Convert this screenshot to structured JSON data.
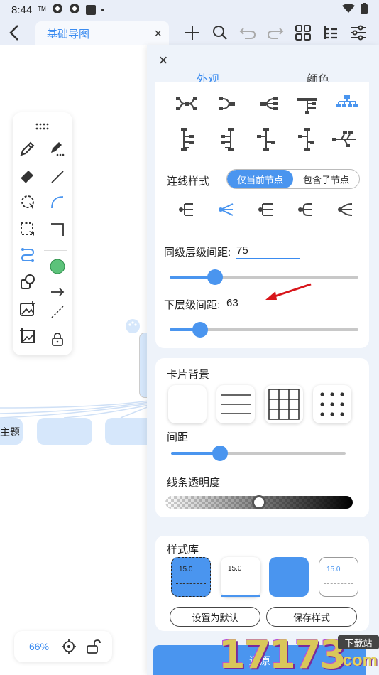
{
  "status_bar": {
    "time": "8:44",
    "network_label": "ᵀᴹ"
  },
  "topbar": {
    "doc_title": "基础导图",
    "close_glyph": "×"
  },
  "canvas": {
    "node_label": "主题"
  },
  "zoom": {
    "value": "66%"
  },
  "panel": {
    "close_glyph": "×",
    "tabs": [
      "外观",
      "颜色"
    ],
    "active_tab": "外观",
    "connector_style": {
      "label": "连线样式",
      "options": [
        "仅当前节点",
        "包含子节点"
      ],
      "selected": "仅当前节点"
    },
    "sibling_spacing": {
      "label": "同级层级间距:",
      "value": "75"
    },
    "child_spacing": {
      "label": "下层级间距:",
      "value": "63"
    },
    "card_background": {
      "label": "卡片背景"
    },
    "spacing": {
      "label": "间距"
    },
    "line_opacity": {
      "label": "线条透明度"
    },
    "style_library": {
      "label": "样式库",
      "swatches": [
        "15.0",
        "15.0",
        "",
        "15.0"
      ],
      "set_default": "设置为默认",
      "save_style": "保存样式"
    },
    "restore_button": "还原"
  },
  "watermark": {
    "number": "17173",
    "badge": "下载站",
    "domain": ".com"
  },
  "colors": {
    "accent": "#4a95ef",
    "active_tab": "#3a8bf0",
    "node_fill": "#d6e7fb",
    "arrow": "#d8161b"
  }
}
